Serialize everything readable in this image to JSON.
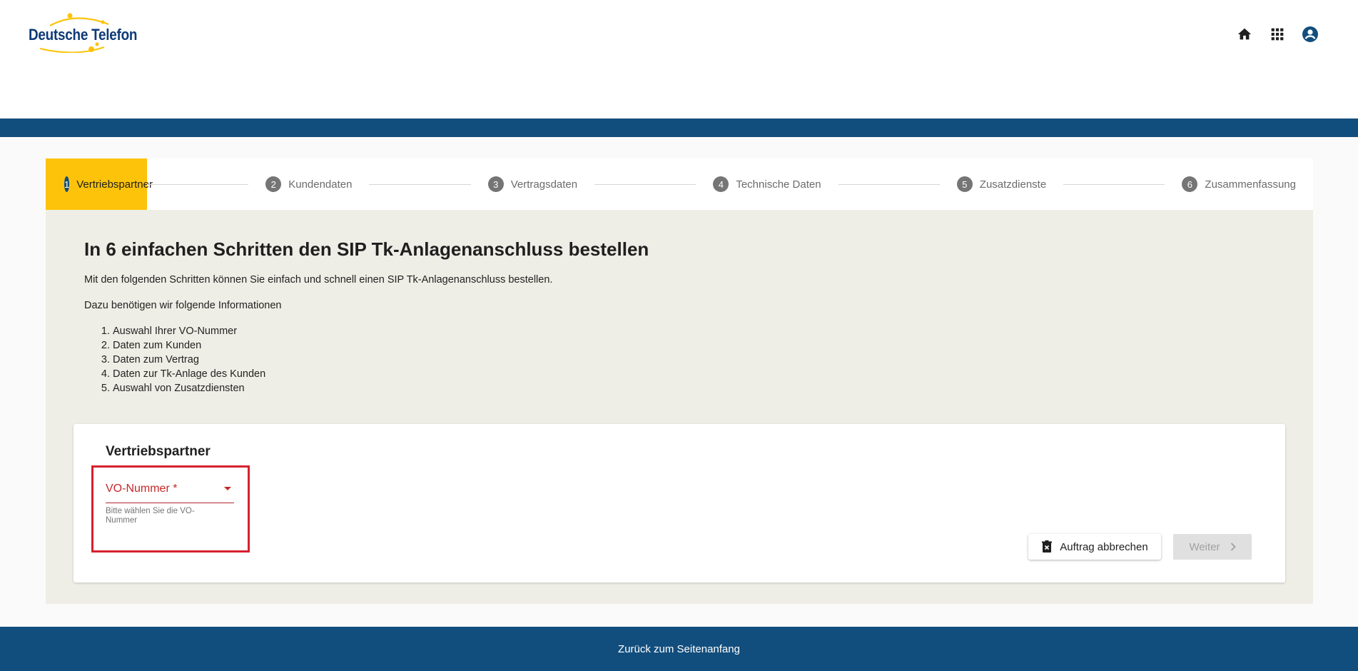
{
  "header": {
    "logo_text": "Deutsche Telefon",
    "icons": [
      "home-icon",
      "apps-grid-icon",
      "account-circle-icon"
    ]
  },
  "colors": {
    "primary_blue": "#124e7d",
    "accent_yellow": "#fdc30a",
    "error_red": "#c62828",
    "content_bg": "#efeee6"
  },
  "stepper": {
    "steps": [
      {
        "num": "1",
        "label": "Vertriebspartner",
        "active": true
      },
      {
        "num": "2",
        "label": "Kundendaten",
        "active": false
      },
      {
        "num": "3",
        "label": "Vertragsdaten",
        "active": false
      },
      {
        "num": "4",
        "label": "Technische Daten",
        "active": false
      },
      {
        "num": "5",
        "label": "Zusatzdienste",
        "active": false
      },
      {
        "num": "6",
        "label": "Zusammenfassung",
        "active": false
      }
    ]
  },
  "intro": {
    "title": "In 6 einfachen Schritten den SIP Tk-Anlagenanschluss bestellen",
    "p1": "Mit den folgenden Schritten können Sie einfach und schnell einen SIP Tk-Anlagenanschluss bestellen.",
    "p2": "Dazu benötigen wir folgende Informationen",
    "list": [
      "Auswahl Ihrer VO-Nummer",
      "Daten zum Kunden",
      "Daten zum Vertrag",
      "Daten zur Tk-Anlage des Kunden",
      "Auswahl von Zusatzdiensten"
    ]
  },
  "card": {
    "title": "Vertriebspartner",
    "select_label": "VO-Nummer *",
    "hint": "Bitte wählen Sie die VO-Nummer",
    "cancel_label": "Auftrag abbrechen",
    "next_label": "Weiter"
  },
  "footer": {
    "link": "Zurück zum Seitenanfang"
  }
}
